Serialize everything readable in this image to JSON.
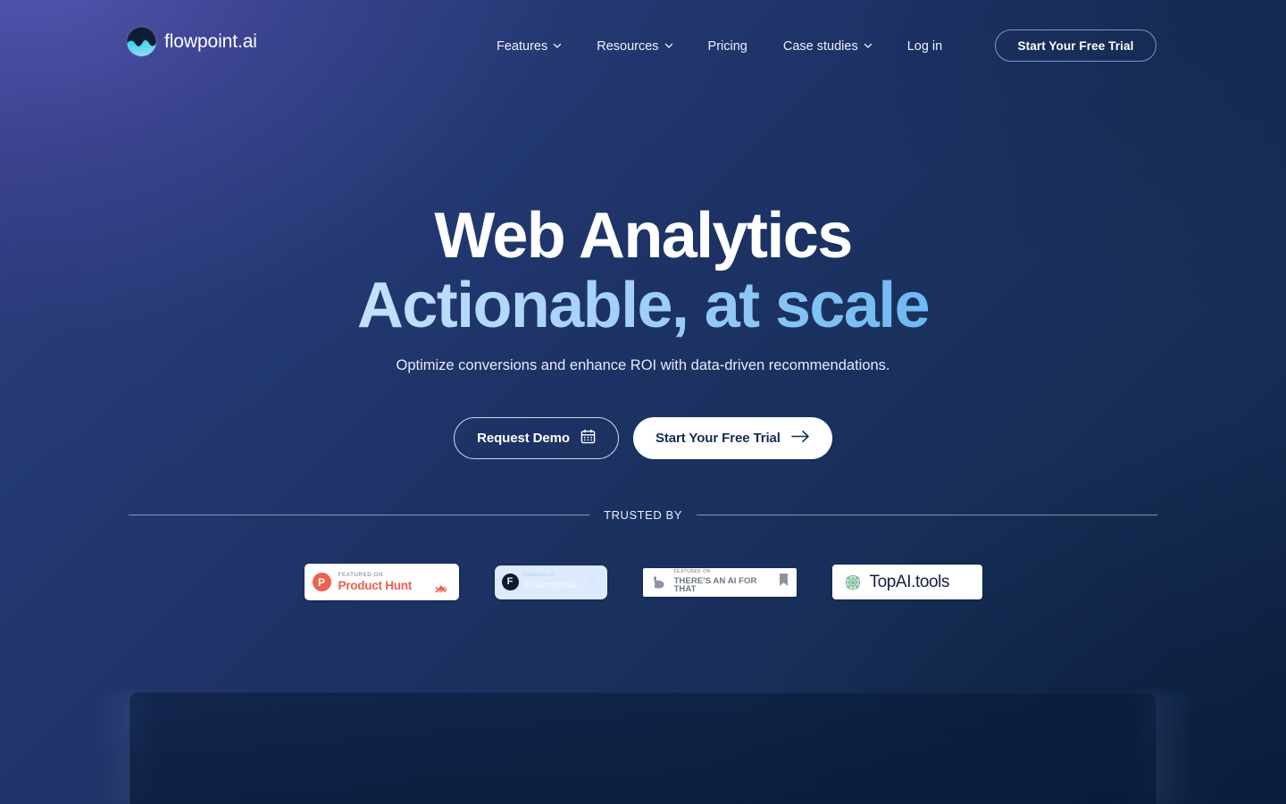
{
  "theme": {
    "bg_top_left": "#3a4090",
    "bg_bottom_right": "#10244a",
    "accent_light_blue": "#5bb3f2",
    "text_white": "#ffffff",
    "product_hunt_red": "#ea6250",
    "futurepedia_bg": "#dceafb",
    "topai_green": "#6ab58b"
  },
  "header": {
    "brand": {
      "name": "flowpoint.ai",
      "logo_icon": "flowpoint-wave-logo-icon"
    },
    "nav": [
      {
        "label": "Features",
        "has_dropdown": true,
        "icon": "chevron-down-icon"
      },
      {
        "label": "Resources",
        "has_dropdown": true,
        "icon": "chevron-down-icon"
      },
      {
        "label": "Pricing",
        "has_dropdown": false
      },
      {
        "label": "Case studies",
        "has_dropdown": true,
        "icon": "chevron-down-icon"
      },
      {
        "label": "Log in",
        "has_dropdown": false
      }
    ],
    "cta_label": "Start Your Free Trial"
  },
  "hero": {
    "headline_line1": "Web Analytics",
    "headline_line2": "Actionable, at scale",
    "subtitle": "Optimize conversions and enhance ROI with data-driven recommendations.",
    "primary_button": {
      "label": "Start Your Free Trial",
      "icon": "arrow-right-icon"
    },
    "secondary_button": {
      "label": "Request Demo",
      "icon": "calendar-icon"
    }
  },
  "trusted_by": {
    "label": "TRUSTED BY",
    "badges": [
      {
        "id": "product-hunt",
        "icon": "product-hunt-icon",
        "icon_letter": "P",
        "eyebrow": "FEATURED ON",
        "name": "Product Hunt",
        "vote_icon": "upvote-triangle-icon",
        "vote_count": "130"
      },
      {
        "id": "futurepedia",
        "icon": "futurepedia-icon",
        "icon_letter": "F",
        "eyebrow": "Featured on",
        "name": "Futurepedia",
        "vote_icon": "bookmark-icon",
        "vote_count": "34"
      },
      {
        "id": "theres-an-ai-for-that",
        "icon": "flexed-arm-icon",
        "eyebrow": "FEATURED ON",
        "name": "THERE'S AN AI FOR THAT",
        "vote_icon": "bookmark-icon"
      },
      {
        "id": "topai-tools",
        "icon": "topai-molecule-icon",
        "name": "TopAI.tools"
      }
    ]
  }
}
